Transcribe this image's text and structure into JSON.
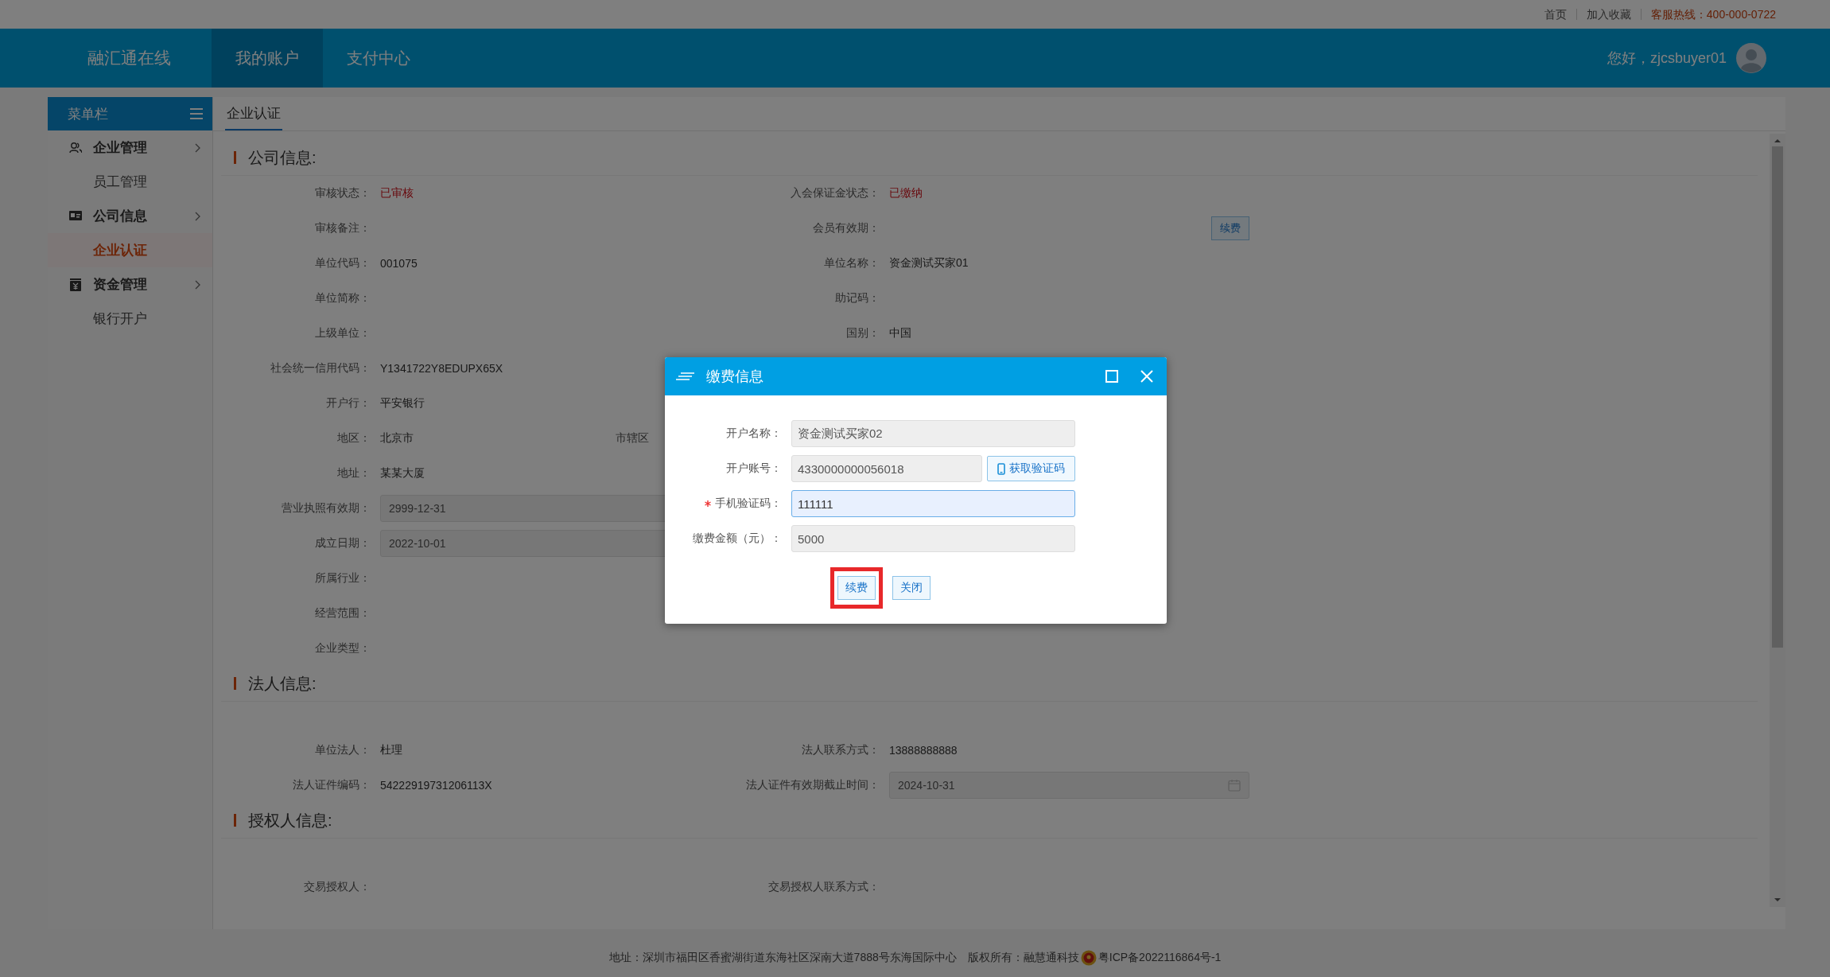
{
  "top_links": [
    {
      "text": "首页",
      "kind": "link"
    },
    {
      "text": "加入收藏",
      "kind": "link"
    },
    {
      "text": "客服热线：400-000-0722",
      "kind": "hotline"
    }
  ],
  "header": {
    "brand": "融汇通在线",
    "nav": [
      {
        "label": "我的账户",
        "selected": true
      },
      {
        "label": "支付中心",
        "selected": false
      }
    ],
    "greeting": "您好，zjcsbuyer01"
  },
  "sidebar": {
    "title": "菜单栏",
    "groups": [
      {
        "label": "企业管理",
        "kind": "people",
        "children": [
          {
            "label": "员工管理",
            "selected": false
          }
        ]
      },
      {
        "label": "公司信息",
        "kind": "card",
        "children": [
          {
            "label": "企业认证",
            "selected": true
          }
        ]
      },
      {
        "label": "资金管理",
        "kind": "money",
        "children": [
          {
            "label": "银行开户",
            "selected": false
          }
        ]
      }
    ]
  },
  "tabs": [
    {
      "label": "企业认证",
      "selected": true
    }
  ],
  "sections": [
    {
      "title": "公司信息:",
      "rows": [
        {
          "left": {
            "label": "审核状态：",
            "value": "已审核",
            "kind": "status"
          },
          "right": {
            "label": "入会保证金状态：",
            "value": "已缴纳",
            "kind": "status"
          }
        },
        {
          "left": {
            "label": "审核备注：",
            "kind": "text"
          },
          "right": {
            "label": "会员有效期：",
            "kind": "text",
            "button": "续费"
          }
        },
        {
          "left": {
            "label": "单位代码：",
            "value": "001075",
            "kind": "text"
          },
          "right": {
            "label": "单位名称：",
            "value": "资金测试买家01",
            "kind": "text"
          }
        },
        {
          "left": {
            "label": "单位简称：",
            "kind": "text"
          },
          "right": {
            "label": "助记码：",
            "kind": "text"
          }
        },
        {
          "left": {
            "label": "上级单位：",
            "kind": "text"
          },
          "right": {
            "label": "国别：",
            "value": "中国",
            "kind": "text"
          }
        },
        {
          "left": {
            "label": "社会统一信用代码：",
            "value": "Y1341722Y8EDUPX65X",
            "kind": "text"
          }
        },
        {
          "left": {
            "label": "开户行：",
            "value": "平安银行",
            "kind": "text"
          }
        },
        {
          "left": {
            "label": "地区：",
            "value": "北京市",
            "kind": "text"
          },
          "middle": {
            "label": "市辖区"
          }
        },
        {
          "left": {
            "label": "地址：",
            "value": "某某大厦",
            "kind": "text"
          }
        },
        {
          "left": {
            "label": "营业执照有效期：",
            "value": "2999-12-31",
            "kind": "date"
          }
        },
        {
          "left": {
            "label": "成立日期：",
            "value": "2022-10-01",
            "kind": "date"
          }
        },
        {
          "left": {
            "label": "所属行业：",
            "kind": "text"
          }
        },
        {
          "left": {
            "label": "经营范围：",
            "kind": "text"
          }
        },
        {
          "left": {
            "label": "企业类型：",
            "kind": "text"
          }
        }
      ]
    },
    {
      "title": "法人信息:",
      "rows": [
        {
          "left": {
            "label": "单位法人：",
            "value": "杜理",
            "kind": "text"
          },
          "right": {
            "label": "法人联系方式：",
            "value": "13888888888",
            "kind": "text"
          }
        },
        {
          "left": {
            "label": "法人证件编码：",
            "value": "54222919731206113X",
            "kind": "text"
          },
          "right": {
            "label": "法人证件有效期截止时间：",
            "value": "2024-10-31",
            "kind": "calendar"
          }
        }
      ]
    },
    {
      "title": "授权人信息:",
      "rows": [
        {
          "left": {
            "label": "交易授权人：",
            "kind": "text"
          },
          "right": {
            "label": "交易授权人联系方式：",
            "kind": "text"
          }
        }
      ]
    }
  ],
  "dialog": {
    "title": "缴费信息",
    "fields": [
      {
        "label": "开户名称：",
        "value": "资金测试买家02",
        "kind": "readonly",
        "required": false
      },
      {
        "label": "开户账号：",
        "value": "4330000000056018",
        "kind": "readonly",
        "required": false,
        "button": "获取验证码"
      },
      {
        "label": "手机验证码：",
        "value": "111111",
        "kind": "input",
        "required": true
      },
      {
        "label": "缴费金额（元）：",
        "value": "5000",
        "kind": "readonly",
        "required": false
      }
    ],
    "buttons": [
      {
        "label": "续费",
        "highlighted": true
      },
      {
        "label": "关闭",
        "highlighted": false
      }
    ]
  },
  "footer": {
    "address": "地址：深圳市福田区香蜜湖街道东海社区深南大道7888号东海国际中心",
    "copyright": "版权所有：融慧通科技",
    "icp": "粤ICP备2022116864号-1"
  }
}
